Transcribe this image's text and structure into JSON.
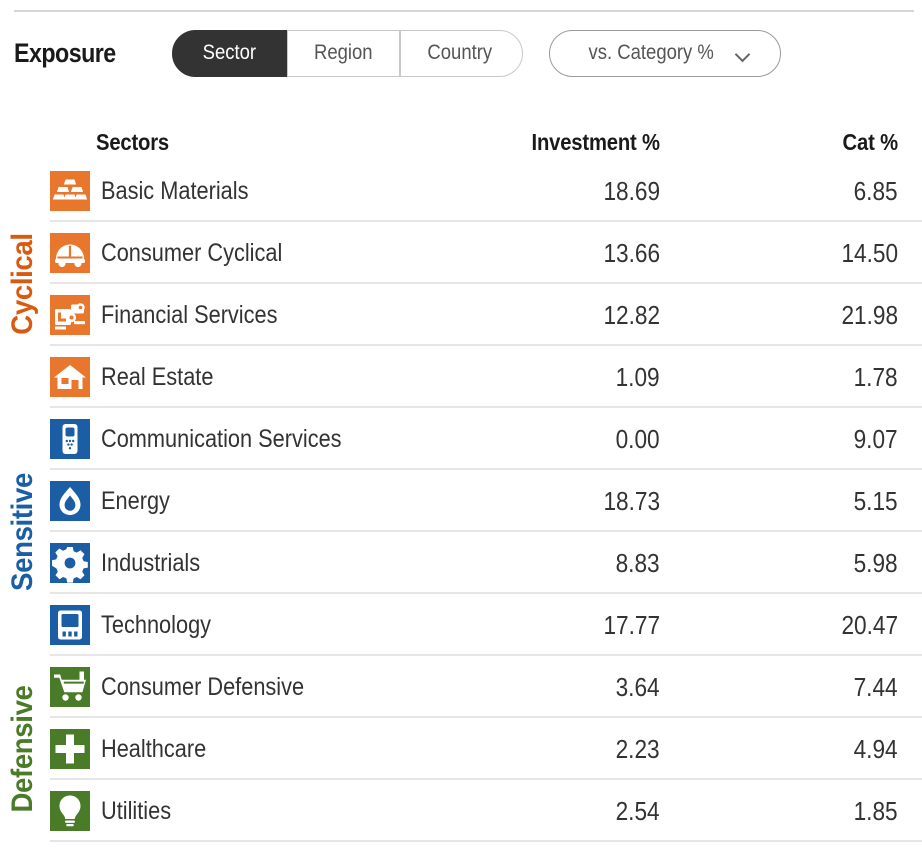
{
  "header": {
    "title": "Exposure",
    "segments": [
      {
        "label": "Sector",
        "active": true
      },
      {
        "label": "Region",
        "active": false
      },
      {
        "label": "Country",
        "active": false
      }
    ],
    "dropdown": {
      "label": "vs. Category %",
      "chevron": "chevron-down-icon"
    }
  },
  "table": {
    "columns": {
      "sector": "Sectors",
      "investment": "Investment  %",
      "category": "Cat  %"
    },
    "groups": [
      {
        "name": "Cyclical",
        "color": "#D8590F",
        "row_count": 4
      },
      {
        "name": "Sensitive",
        "color": "#1B5EA6",
        "row_count": 4
      },
      {
        "name": "Defensive",
        "color": "#4A7B28",
        "row_count": 3
      }
    ],
    "rows": [
      {
        "icon": "basic-materials-icon",
        "group": "Cyclical",
        "color": "#E8762C",
        "name": "Basic Materials",
        "investment": "18.69",
        "category": "6.85"
      },
      {
        "icon": "consumer-cyclical-icon",
        "group": "Cyclical",
        "color": "#E8762C",
        "name": "Consumer Cyclical",
        "investment": "13.66",
        "category": "14.50"
      },
      {
        "icon": "financial-services-icon",
        "group": "Cyclical",
        "color": "#E8762C",
        "name": "Financial Services",
        "investment": "12.82",
        "category": "21.98"
      },
      {
        "icon": "real-estate-icon",
        "group": "Cyclical",
        "color": "#E8762C",
        "name": "Real Estate",
        "investment": "1.09",
        "category": "1.78"
      },
      {
        "icon": "communication-services-icon",
        "group": "Sensitive",
        "color": "#1B5EA6",
        "name": "Communication Services",
        "investment": "0.00",
        "category": "9.07"
      },
      {
        "icon": "energy-icon",
        "group": "Sensitive",
        "color": "#1B5EA6",
        "name": "Energy",
        "investment": "18.73",
        "category": "5.15"
      },
      {
        "icon": "industrials-icon",
        "group": "Sensitive",
        "color": "#1B5EA6",
        "name": "Industrials",
        "investment": "8.83",
        "category": "5.98"
      },
      {
        "icon": "technology-icon",
        "group": "Sensitive",
        "color": "#1B5EA6",
        "name": "Technology",
        "investment": "17.77",
        "category": "20.47"
      },
      {
        "icon": "consumer-defensive-icon",
        "group": "Defensive",
        "color": "#4A7B28",
        "name": "Consumer Defensive",
        "investment": "3.64",
        "category": "7.44"
      },
      {
        "icon": "healthcare-icon",
        "group": "Defensive",
        "color": "#4A7B28",
        "name": "Healthcare",
        "investment": "2.23",
        "category": "4.94"
      },
      {
        "icon": "utilities-icon",
        "group": "Defensive",
        "color": "#4A7B28",
        "name": "Utilities",
        "investment": "2.54",
        "category": "1.85"
      }
    ]
  },
  "chart_data": {
    "type": "table",
    "title": "Exposure — Sector, vs. Category %",
    "categories": [
      "Basic Materials",
      "Consumer Cyclical",
      "Financial Services",
      "Real Estate",
      "Communication Services",
      "Energy",
      "Industrials",
      "Technology",
      "Consumer Defensive",
      "Healthcare",
      "Utilities"
    ],
    "series": [
      {
        "name": "Investment %",
        "values": [
          18.69,
          13.66,
          12.82,
          1.09,
          0.0,
          18.73,
          8.83,
          17.77,
          3.64,
          2.23,
          2.54
        ]
      },
      {
        "name": "Cat %",
        "values": [
          6.85,
          14.5,
          21.98,
          1.78,
          9.07,
          5.15,
          5.98,
          20.47,
          7.44,
          4.94,
          1.85
        ]
      }
    ],
    "xlabel": "Sectors",
    "ylabel": "%",
    "grid": false,
    "legend": "none"
  }
}
